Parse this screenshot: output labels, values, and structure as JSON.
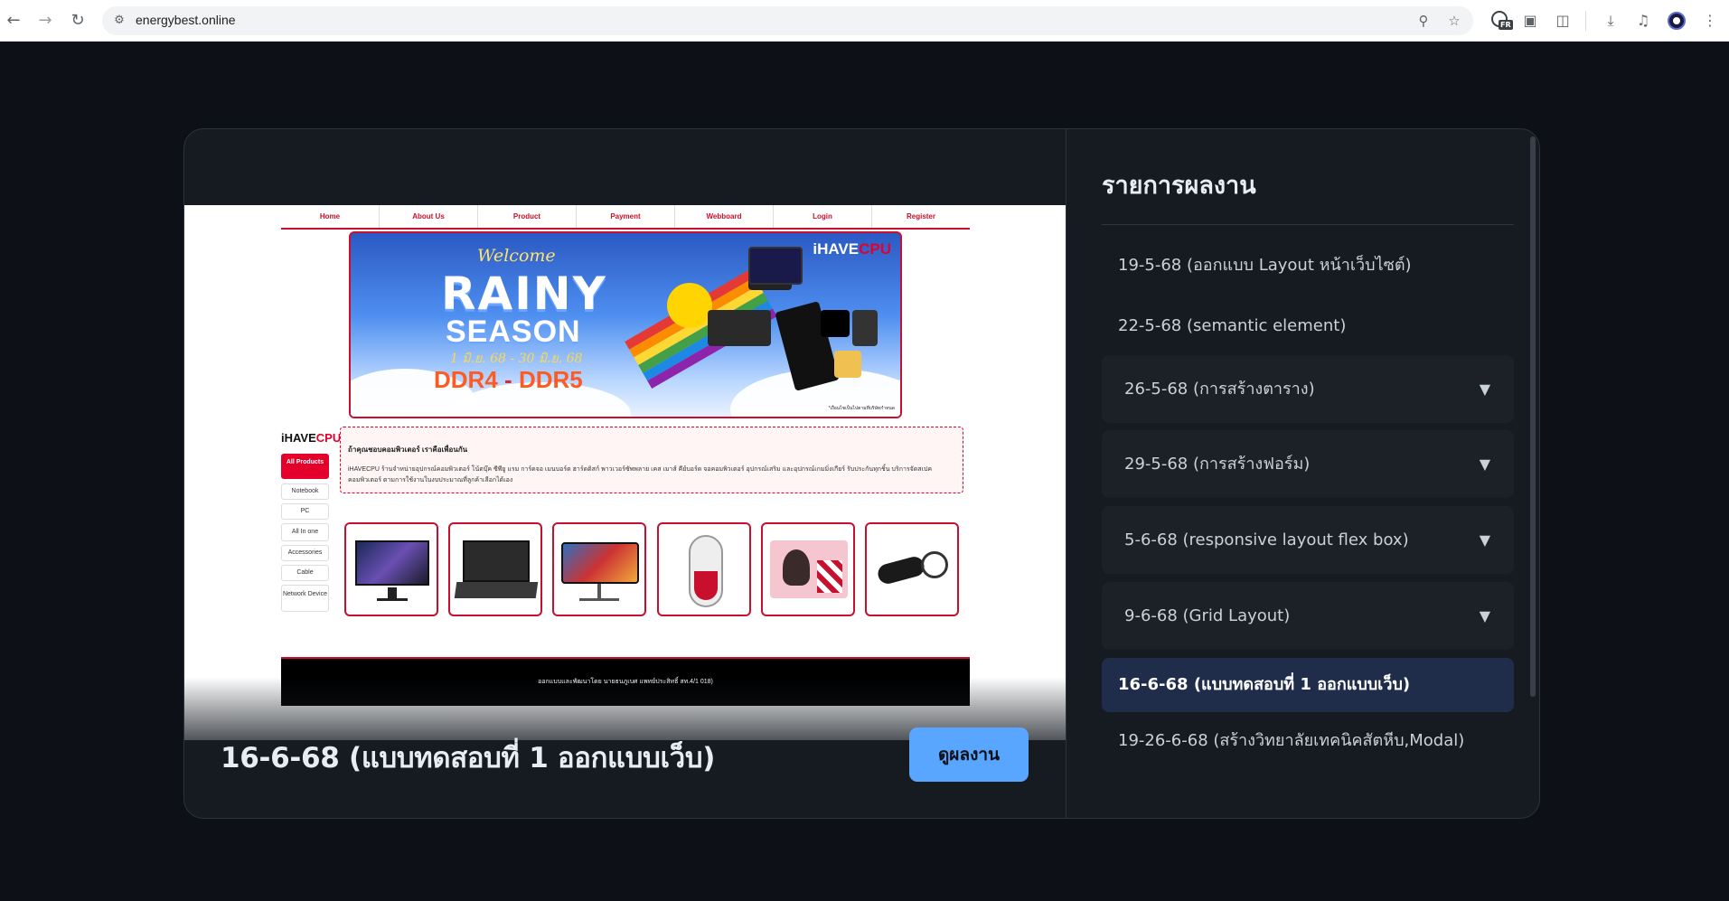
{
  "browser": {
    "url": "energybest.online",
    "translate_badge": "FR",
    "icons": {
      "back": "back-arrow-icon",
      "forward": "forward-arrow-icon",
      "reload": "reload-icon",
      "site_info": "tune-icon",
      "zoom": "zoom-icon",
      "bookmark": "star-icon",
      "translate": "translate-icon",
      "screenshot": "camera-icon",
      "extensions": "puzzle-icon",
      "download": "download-icon",
      "media": "media-control-icon",
      "profile": "profile-avatar-icon",
      "menu": "kebab-menu-icon"
    }
  },
  "preview": {
    "site": {
      "nav": [
        "Home",
        "About Us",
        "Product",
        "Payment",
        "Webboard",
        "Login",
        "Register"
      ],
      "banner": {
        "welcome": "Welcome",
        "headline_1": "RAINY",
        "headline_2": "SEASON",
        "dates": "1 มิ.ย. 68 - 30 มิ.ย. 68",
        "ddr4": "DDR4",
        "dash": "-",
        "ddr5": "DDR5",
        "brand_1": "iHAVE",
        "brand_2": "CPU",
        "fine_print": "*เงื่อนไขเป็นไปตามที่บริษัทกำหนด"
      },
      "logo_1": "iHAVE",
      "logo_2": "CPU",
      "categories": [
        "All Products",
        "Notebook",
        "PC",
        "All In one",
        "Accessories",
        "Cable",
        "Network Device"
      ],
      "intro_heading": "ถ้าคุณชอบคอมพิวเตอร์ เราคือเพื่อนกัน",
      "intro_text": "iHAVECPU ร้านจำหน่ายอุปกรณ์คอมพิวเตอร์ โน้ตบุ๊ค ซีพียู แรม การ์ดจอ เมนบอร์ด ฮาร์ดดิสก์ พาวเวอร์ซัพพลาย เคส เมาส์ คีย์บอร์ด จอคอมพิวเตอร์ อุปกรณ์เสริม และอุปกรณ์เกมมิ่งเกียร์ รับประกันทุกชิ้น บริการจัดสเปคคอมพิวเตอร์ ตามการใช้งานในงบประมาณที่ลูกค้าเลือกได้เอง",
      "products": [
        "monitor-product",
        "laptop-product",
        "curved-monitor-product",
        "gaming-mouse-product",
        "anime-mousepad-product",
        "microphone-product"
      ],
      "footer": "ออกแบบและพัฒนาโดย นายธนภูเบศ แพทย์ประสิทธิ์ สท.4/1 018)"
    },
    "caption": "16-6-68 (แบบทดสอบที่ 1 ออกแบบเว็บ)",
    "view_button": "ดูผลงาน"
  },
  "worklist": {
    "title": "รายการผลงาน",
    "items": [
      {
        "label": "19-5-68 (ออกแบบ Layout หน้าเว็บไซต์)",
        "style": "plain"
      },
      {
        "label": "22-5-68 (semantic element)",
        "style": "plain"
      },
      {
        "label": "26-5-68 (การสร้างตาราง)",
        "style": "box",
        "arrow": "▼"
      },
      {
        "label": "29-5-68 (การสร้างฟอร์ม)",
        "style": "box",
        "arrow": "▼"
      },
      {
        "label": "5-6-68 (responsive layout flex box)",
        "style": "box",
        "arrow": "▼"
      },
      {
        "label": "9-6-68 (Grid Layout)",
        "style": "box",
        "arrow": "▼"
      },
      {
        "label": "16-6-68 (แบบทดสอบที่ 1 ออกแบบเว็บ)",
        "style": "active"
      },
      {
        "label": "19-26-6-68 (สร้างวิทยาลัยเทคนิคสัตหีบ,Modal)",
        "style": "plain"
      }
    ]
  }
}
